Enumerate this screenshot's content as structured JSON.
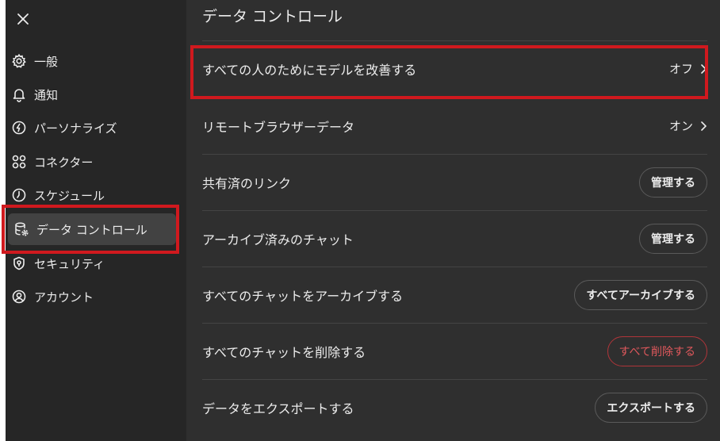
{
  "sidebar": {
    "items": [
      {
        "label": "一般",
        "icon": "gear-icon"
      },
      {
        "label": "通知",
        "icon": "bell-icon"
      },
      {
        "label": "パーソナライズ",
        "icon": "personalize-icon"
      },
      {
        "label": "コネクター",
        "icon": "connector-icon"
      },
      {
        "label": "スケジュール",
        "icon": "clock-icon"
      },
      {
        "label": "データ コントロール",
        "icon": "database-gear-icon",
        "active": true
      },
      {
        "label": "セキュリティ",
        "icon": "shield-icon"
      },
      {
        "label": "アカウント",
        "icon": "user-circle-icon"
      }
    ]
  },
  "main": {
    "title": "データ コントロール",
    "rows": [
      {
        "label": "すべての人のためにモデルを改善する",
        "value": "オフ"
      },
      {
        "label": "リモートブラウザーデータ",
        "value": "オン"
      },
      {
        "label": "共有済のリンク",
        "button": "管理する"
      },
      {
        "label": "アーカイブ済みのチャット",
        "button": "管理する"
      },
      {
        "label": "すべてのチャットをアーカイブする",
        "button": "すべてアーカイブする"
      },
      {
        "label": "すべてのチャットを削除する",
        "button": "すべて削除する"
      },
      {
        "label": "データをエクスポートする",
        "button": "エクスポートする"
      }
    ]
  },
  "colors": {
    "highlight": "#d0191e",
    "danger": "#e0585c"
  }
}
